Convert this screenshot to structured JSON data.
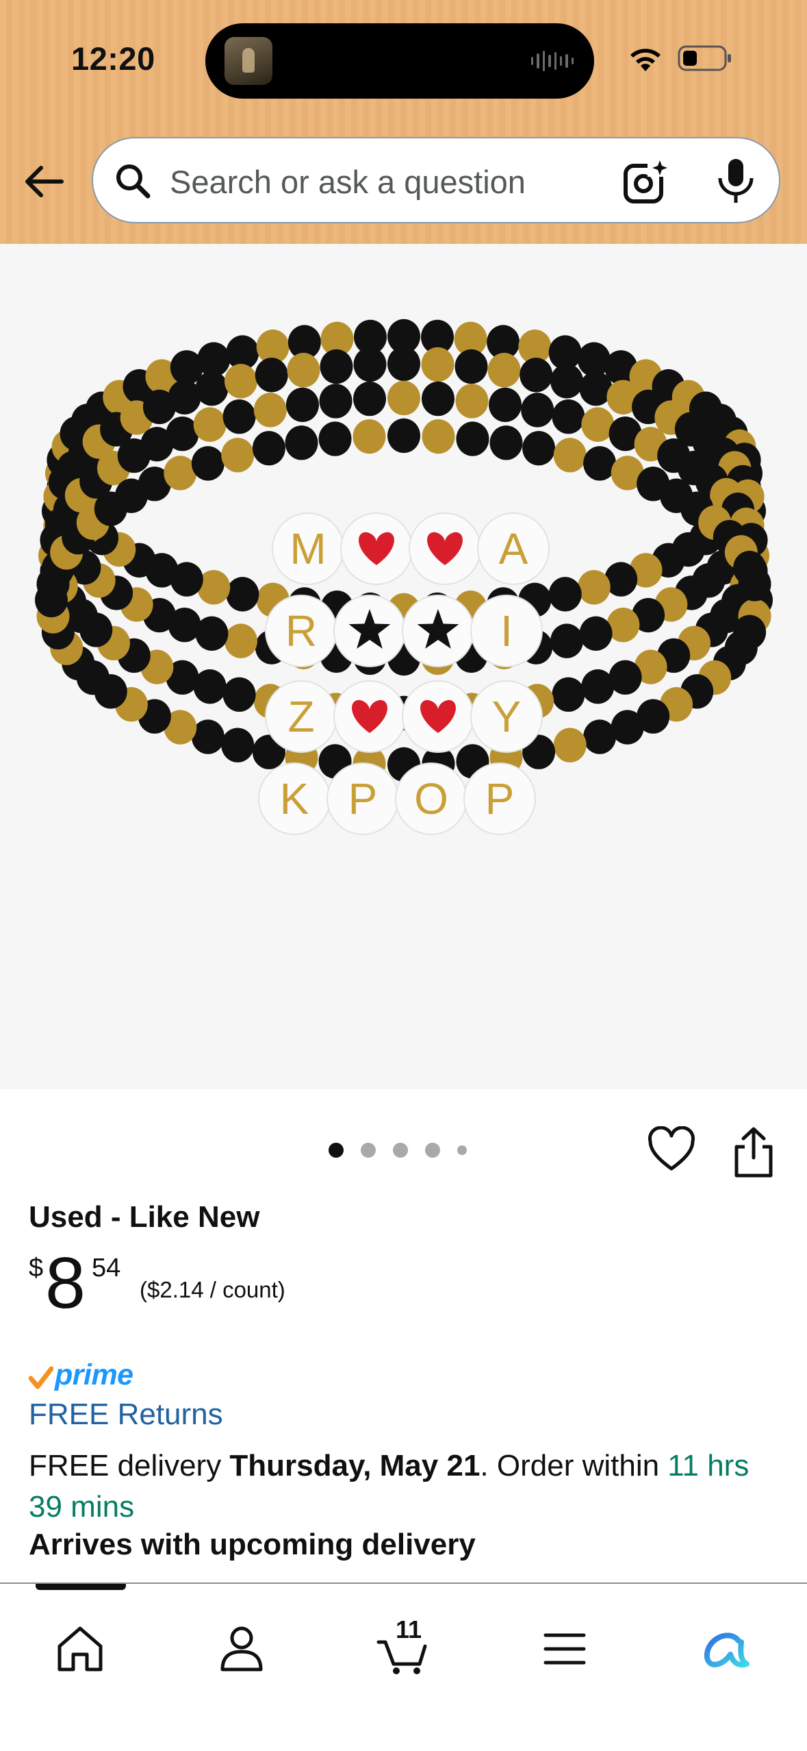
{
  "status_bar": {
    "time": "12:20"
  },
  "search": {
    "placeholder": "Search or ask a question"
  },
  "product": {
    "image_count": 5,
    "current_image_index": 0,
    "bead_letters": [
      "M",
      "A",
      "R",
      "I",
      "Z",
      "Y",
      "K",
      "P",
      "O",
      "P"
    ],
    "condition": "Used - Like New",
    "price_symbol": "$",
    "price_whole": "8",
    "price_fraction": "54",
    "unit_price": "($2.14 / count)"
  },
  "shipping": {
    "prime_label": "prime",
    "free_returns": "FREE Returns",
    "delivery_prefix": "FREE delivery ",
    "delivery_date": "Thursday, May 21",
    "order_within_prefix": ". Order within ",
    "order_within_time": "11 hrs 39 mins",
    "arrives_note": "Arrives with upcoming delivery"
  },
  "bottom_nav": {
    "cart_count": "11",
    "items": [
      "home-icon",
      "account-icon",
      "cart-icon",
      "menu-icon",
      "rufus-icon"
    ]
  },
  "colors": {
    "header_bg": "#ecb77c",
    "link_blue": "#2162a1",
    "deal_green": "#067d62",
    "prime_blue": "#1a98ff",
    "prime_check": "#f5911e"
  }
}
